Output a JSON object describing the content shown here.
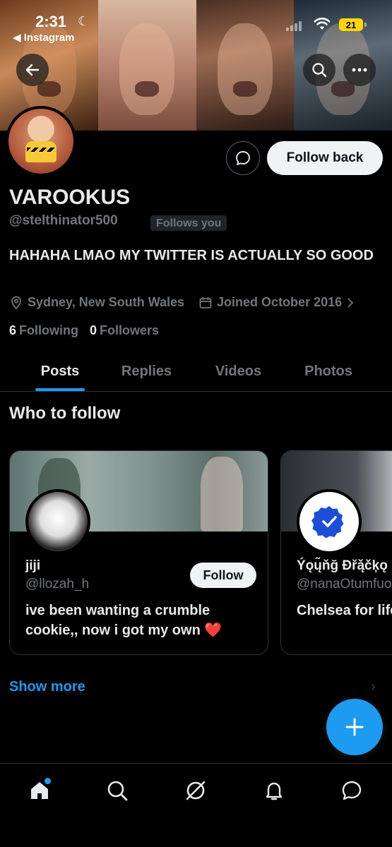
{
  "status_bar": {
    "time": "2:31",
    "back_app": "Instagram",
    "battery": "21"
  },
  "profile": {
    "name": "VAROOKUS",
    "handle": "@stelthinator500",
    "follows_you": "Follows you",
    "bio": "HAHAHA LMAO MY TWITTER IS ACTUALLY SO GOOD",
    "location": "Sydney, New South Wales",
    "joined": "Joined October 2016",
    "following_count": "6",
    "following_label": "Following",
    "followers_count": "0",
    "followers_label": "Followers",
    "follow_back_label": "Follow back"
  },
  "tabs": [
    {
      "label": "Posts",
      "active": true
    },
    {
      "label": "Replies",
      "active": false
    },
    {
      "label": "Videos",
      "active": false
    },
    {
      "label": "Photos",
      "active": false
    }
  ],
  "who_to_follow": {
    "title": "Who to follow",
    "cards": [
      {
        "name": "jiji",
        "handle": "@llozah_h",
        "follow_label": "Follow",
        "bio": "ive been wanting a crumble cookie,, now i got my own ❤️"
      },
      {
        "name": "Ýǫų̃ňğ Đřą̌čķǫ",
        "handle": "@nanaOtumfuo",
        "bio": "Chelsea for life"
      }
    ],
    "show_more": "Show more"
  },
  "colors": {
    "accent": "#1d9bf0",
    "background": "#000000",
    "muted_text": "#71767b"
  },
  "icons": {
    "back": "arrow-left-icon",
    "search": "search-icon",
    "more": "more-horizontal-icon",
    "message": "message-bubble-icon",
    "location": "location-pin-icon",
    "calendar": "calendar-icon",
    "compose": "plus-icon",
    "nav": [
      "home-icon",
      "search-icon",
      "grok-icon",
      "bell-icon",
      "messages-icon"
    ]
  }
}
